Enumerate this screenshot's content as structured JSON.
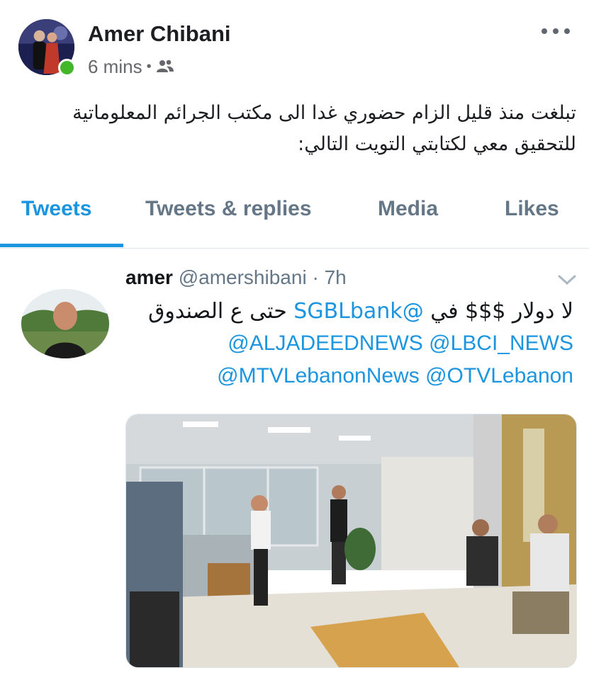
{
  "post": {
    "author": "Amer Chibani",
    "time": "6 mins",
    "separator": "•",
    "privacy_icon": "friends-icon",
    "body_line1": "تبلغت منذ قليل الزام حضوري غدا الى مكتب الجرائم المعلوماتية",
    "body_line2": "للتحقيق معي لكتابتي التويت التالي:"
  },
  "tabs": [
    {
      "label": "Tweets",
      "active": true
    },
    {
      "label": "Tweets & replies",
      "active": false
    },
    {
      "label": "Media",
      "active": false
    },
    {
      "label": "Likes",
      "active": false
    }
  ],
  "tweet": {
    "name": "amer",
    "handle": "@amershibani",
    "separator": "·",
    "time": "7h",
    "line1_pre": "لا دولار $$$ في ",
    "line1_mention": "@SGBLbank",
    "line1_post": " حتى ع الصندوق",
    "mentions_line2": [
      "@ALJADEEDNEWS",
      "@LBCI_NEWS"
    ],
    "mentions_line3": [
      "@MTVLebanonNews",
      "@OTVLebanon"
    ]
  },
  "colors": {
    "twitter_blue": "#1b95e0",
    "online_green": "#42b72a",
    "muted_text": "#657786"
  }
}
